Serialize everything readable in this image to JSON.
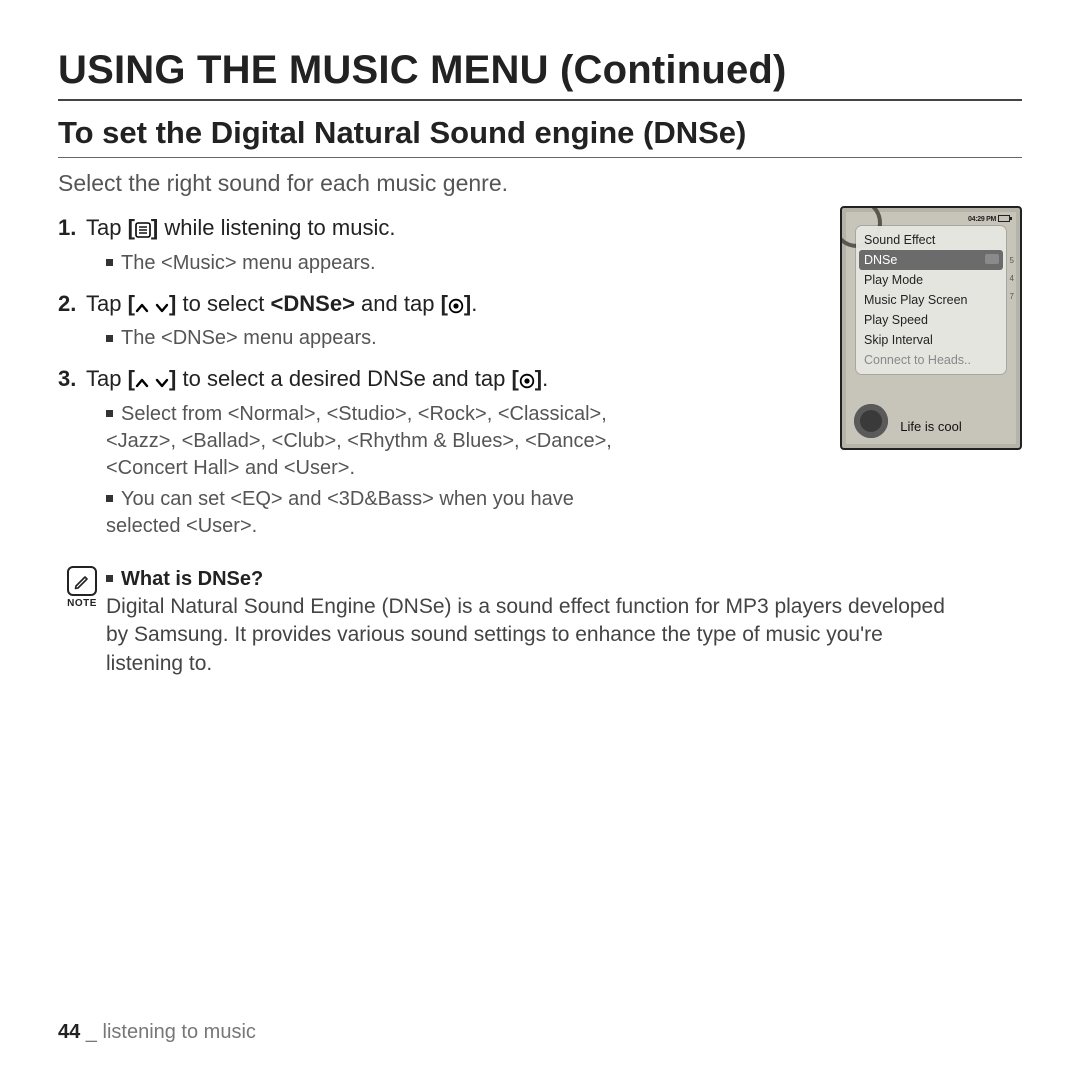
{
  "title": "USING THE MUSIC MENU (Continued)",
  "subtitle": "To set the Digital Natural Sound engine (DNSe)",
  "intro": "Select the right sound for each music genre.",
  "steps": [
    {
      "num": "1.",
      "text_a": "Tap ",
      "text_b": " while listening to music.",
      "sub": "The <Music> menu appears."
    },
    {
      "num": "2.",
      "text_a": "Tap ",
      "mid": " to select ",
      "bold": "<DNSe>",
      "mid2": " and tap ",
      "end": ".",
      "sub": "The <DNSe> menu appears."
    },
    {
      "num": "3.",
      "text_a": "Tap ",
      "mid": " to select a desired DNSe and tap ",
      "end": ".",
      "sub1": "Select from <Normal>, <Studio>, <Rock>, <Classical>, <Jazz>, <Ballad>, <Club>, <Rhythm & Blues>, <Dance>, <Concert Hall>  and <User>.",
      "sub2": "You can set <EQ> and <3D&Bass> when you have selected <User>."
    }
  ],
  "note": {
    "label": "NOTE",
    "q": "What is DNSe?",
    "body": "Digital Natural Sound Engine (DNSe) is a sound effect function for MP3 players developed by Samsung. It provides various sound settings to enhance the type of music you're listening to."
  },
  "footer": {
    "page": "44",
    "sep": " _ ",
    "section": "listening to music"
  },
  "device": {
    "status_time": "04:29 PM",
    "menu": [
      "Sound Effect",
      "DNSe",
      "Play Mode",
      "Music Play Screen",
      "Play Speed",
      "Skip Interval",
      "Connect to Heads.."
    ],
    "selected_index": 1,
    "now_playing": "Life is cool",
    "side_nums": [
      "5",
      "4",
      "7"
    ]
  }
}
